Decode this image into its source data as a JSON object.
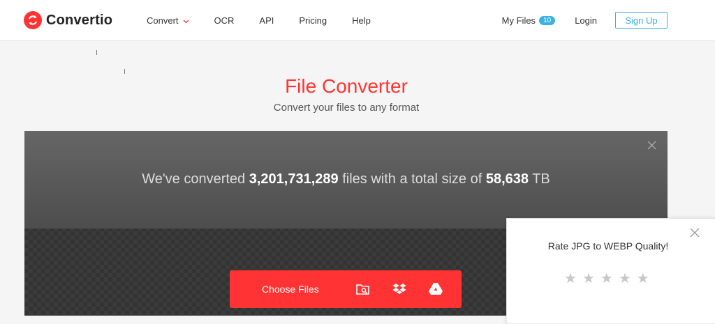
{
  "header": {
    "logo_text": "Convertio",
    "nav": {
      "convert": "Convert",
      "ocr": "OCR",
      "api": "API",
      "pricing": "Pricing",
      "help": "Help"
    },
    "my_files_label": "My Files",
    "my_files_count": "10",
    "login_label": "Login",
    "signup_label": "Sign Up"
  },
  "hero": {
    "title": "File Converter",
    "subtitle": "Convert your files to any format"
  },
  "stats": {
    "prefix": "We've converted ",
    "files_count": "3,201,731,289",
    "middle": " files with a total size of ",
    "total_size": "58,638",
    "suffix": " TB"
  },
  "upload": {
    "choose_label": "Choose Files"
  },
  "rating": {
    "title": "Rate JPG to WEBP Quality!",
    "stars": [
      "★",
      "★",
      "★",
      "★",
      "★"
    ]
  },
  "colors": {
    "brand_red": "#ff3333",
    "accent_blue": "#3cb1e3"
  }
}
